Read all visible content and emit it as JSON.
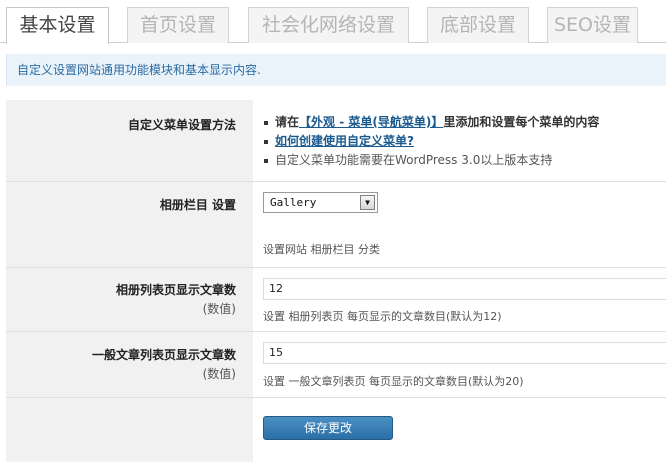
{
  "tabs": [
    {
      "label": "基本设置",
      "active": true
    },
    {
      "label": "首页设置",
      "active": false
    },
    {
      "label": "社会化网络设置",
      "active": false
    },
    {
      "label": "底部设置",
      "active": false
    },
    {
      "label": "SEO设置",
      "active": false
    }
  ],
  "notice": "自定义设置网站通用功能模块和基本显示内容.",
  "menu_section": {
    "label": "自定义菜单设置方法",
    "line1_prefix": "请在",
    "line1_link": "【外观 - 菜单(导航菜单)】",
    "line1_suffix": "里添加和设置每个菜单的内容",
    "line2_link": "如何创建使用自定义菜单?",
    "line3": "自定义菜单功能需要在WordPress 3.0以上版本支持"
  },
  "gallery_section": {
    "label": "相册栏目 设置",
    "selected": "Gallery",
    "hint": "设置网站 相册栏目 分类"
  },
  "album_count": {
    "label": "相册列表页显示文章数",
    "sublabel": "(数值)",
    "value": "12",
    "hint": "设置 相册列表页 每页显示的文章数目(默认为12)"
  },
  "post_count": {
    "label": "一般文章列表页显示文章数",
    "sublabel": "(数值)",
    "value": "15",
    "hint": "设置 一般文章列表页 每页显示的文章数目(默认为20)"
  },
  "save_label": "保存更改",
  "colors": {
    "accent": "#2a6fa6",
    "notice_bg": "#eaf2fa",
    "label_bg": "#f1f1f1"
  },
  "icons": {
    "select_arrow": "chevron-down-icon"
  }
}
